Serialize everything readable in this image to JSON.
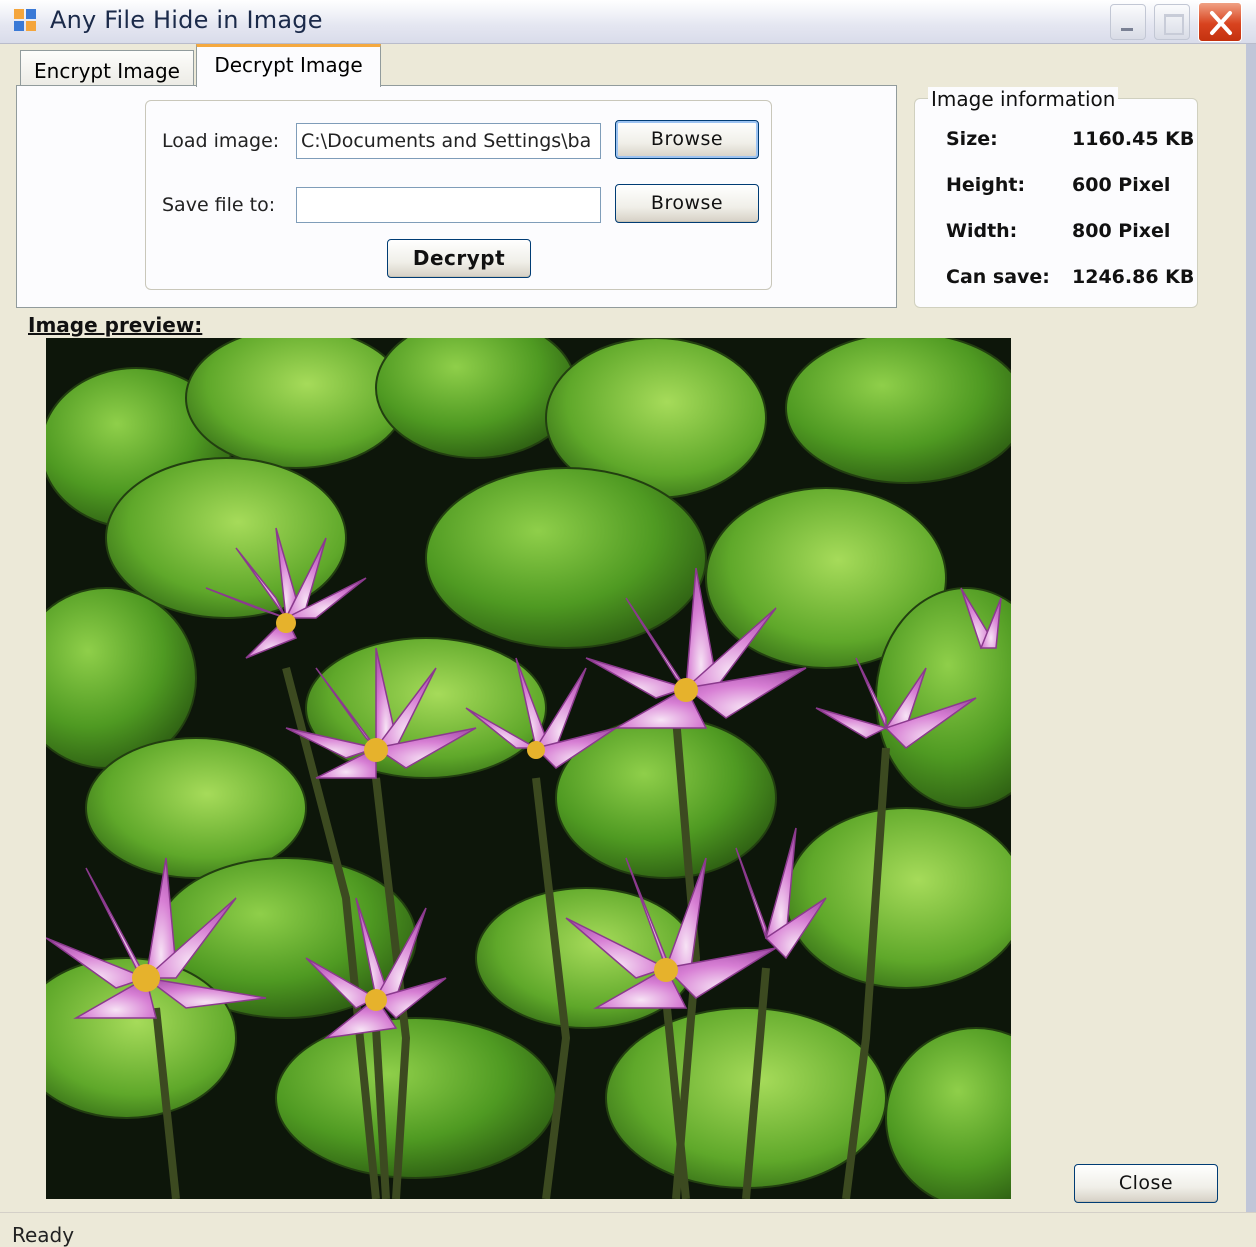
{
  "window": {
    "title": "Any File Hide in Image",
    "icons": {
      "app": "app-icon",
      "minimize": "minimize-icon",
      "maximize": "maximize-icon",
      "close": "close-icon"
    }
  },
  "tabs": [
    {
      "label": "Encrypt Image",
      "active": false
    },
    {
      "label": "Decrypt Image",
      "active": true
    }
  ],
  "decrypt": {
    "load_label": "Load image:",
    "load_value": "C:\\Documents and Settings\\ba",
    "save_label": "Save file to:",
    "save_value": "",
    "browse_label": "Browse",
    "decrypt_label": "Decrypt"
  },
  "image_info": {
    "legend": "Image information",
    "rows": [
      {
        "key": "Size:",
        "value": "1160.45 KB"
      },
      {
        "key": "Height:",
        "value": "600 Pixel"
      },
      {
        "key": "Width:",
        "value": "800 Pixel"
      },
      {
        "key": "Can save:",
        "value": "1246.86 KB"
      }
    ]
  },
  "preview": {
    "label": "Image preview:"
  },
  "close_label": "Close",
  "status": "Ready",
  "colors": {
    "accent_tab": "#f5a940",
    "window_bg": "#ece9d8",
    "close_red": "#d8431f",
    "button_border": "#003c74"
  }
}
